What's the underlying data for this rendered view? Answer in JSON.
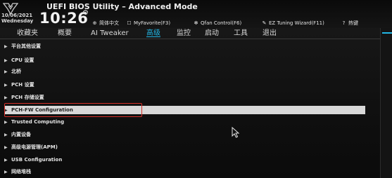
{
  "header": {
    "date_line1": "10/06/2021",
    "date_line2": "Wednesday",
    "time": "10:26",
    "title": "UEFI BIOS Utility – Advanced Mode",
    "items": [
      {
        "icon": "globe-icon",
        "label": "简体中文"
      },
      {
        "icon": "star-icon",
        "label": "MyFavorite(F3)"
      },
      {
        "icon": "fan-icon",
        "label": "Qfan Control(F6)"
      },
      {
        "icon": "wand-icon",
        "label": "EZ Tuning Wizard(F11)"
      },
      {
        "icon": "help-icon",
        "label": "热键"
      }
    ]
  },
  "tabs": [
    "收藏夹",
    "概要",
    "AI Tweaker",
    "高级",
    "监控",
    "启动",
    "工具",
    "退出"
  ],
  "active_tab": "高级",
  "menu": {
    "items": [
      "平台其他设置",
      "CPU 设置",
      "北桥",
      "PCH 设置",
      "PCH 存储设置",
      "PCH-FW Configuration",
      "Trusted Computing",
      "内置设备",
      "高级电源管理(APM)",
      "USB Configuration",
      "网络堆栈"
    ],
    "selected": "PCH-FW Configuration"
  },
  "colors": {
    "accent": "#22b7e6",
    "highlight_border": "#d6312a",
    "selected_row_bg": "#d8d8d8"
  }
}
